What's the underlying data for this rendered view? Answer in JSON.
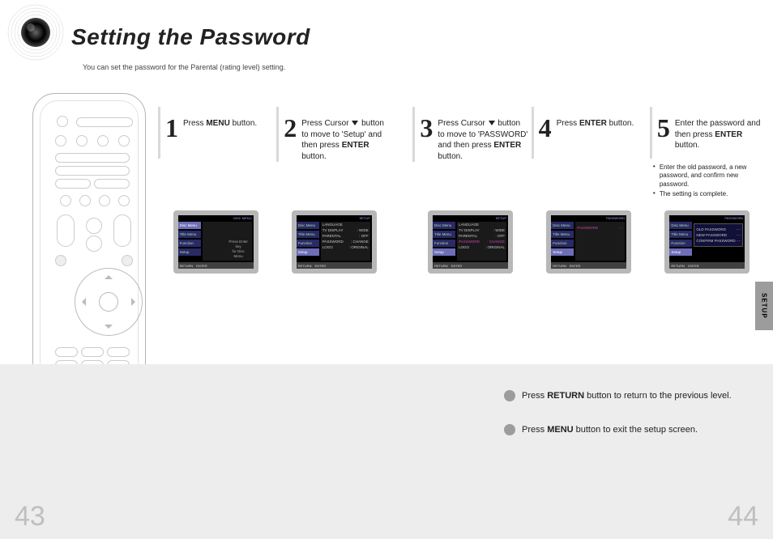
{
  "heading": "Setting the Password",
  "subheading": "You can set the password for the Parental (rating level) setting.",
  "side_tab": "SETUP",
  "page_left": "43",
  "page_right": "44",
  "steps": {
    "s1": {
      "num": "1",
      "text_prefix": "Press ",
      "bold1": "MENU",
      "text_suffix": " button."
    },
    "s2": {
      "num": "2",
      "text_prefix": "Press Cursor ",
      "text_mid": " button to move to 'Setup' and then press ",
      "bold1": "ENTER",
      "text_suffix": " button."
    },
    "s3": {
      "num": "3",
      "text_prefix": "Press Cursor ",
      "text_mid": " button to move to 'PASSWORD' and then press ",
      "bold1": "ENTER",
      "text_suffix": " button."
    },
    "s4": {
      "num": "4",
      "text_prefix": "Press ",
      "bold1": "ENTER",
      "text_suffix": " button."
    },
    "s5": {
      "num": "5",
      "text_prefix": "Enter the password and then press ",
      "bold1": "ENTER",
      "text_suffix": " button."
    }
  },
  "bullets": {
    "b1": "Enter the old password, a new password, and confirm new password.",
    "b2": "The setting is complete."
  },
  "screen_sidebar": [
    "Disc Menu",
    "Title Menu",
    "Function",
    "Setup"
  ],
  "screen1": {
    "topbar_r": "DISC MENU",
    "center1": "Press Enter key",
    "center2": "for Disc Menu"
  },
  "screen2": {
    "topbar_r": "SETUP",
    "rows": [
      {
        "l": "LANGUAGE",
        "r": ""
      },
      {
        "l": "TV DISPLAY",
        "r": ": WIDE"
      },
      {
        "l": "PARENTAL",
        "r": ": OFF"
      },
      {
        "l": "PASSWORD",
        "r": ": CHANGE"
      },
      {
        "l": "LOGO",
        "r": ": ORIGINAL"
      }
    ]
  },
  "screen4": {
    "topbar_r": "PASSWORD",
    "rows": [
      {
        "l": "PASSWORD",
        "r": "····"
      }
    ]
  },
  "screen5": {
    "topbar_r": "PASSWORD",
    "rows": [
      {
        "l": "OLD PASSWORD",
        "r": "····"
      },
      {
        "l": "NEW PASSWORD",
        "r": "····"
      },
      {
        "l": "CONFIRM PASSWORD",
        "r": "····"
      }
    ]
  },
  "screen_footer": {
    "a": "RETURN",
    "b": "ENTER"
  },
  "notes": {
    "n1_pre": "Press ",
    "n1_bold": "RETURN",
    "n1_post": " button to return to the previous level.",
    "n2_pre": "Press ",
    "n2_bold": "MENU",
    "n2_post": " button to exit the setup screen."
  }
}
